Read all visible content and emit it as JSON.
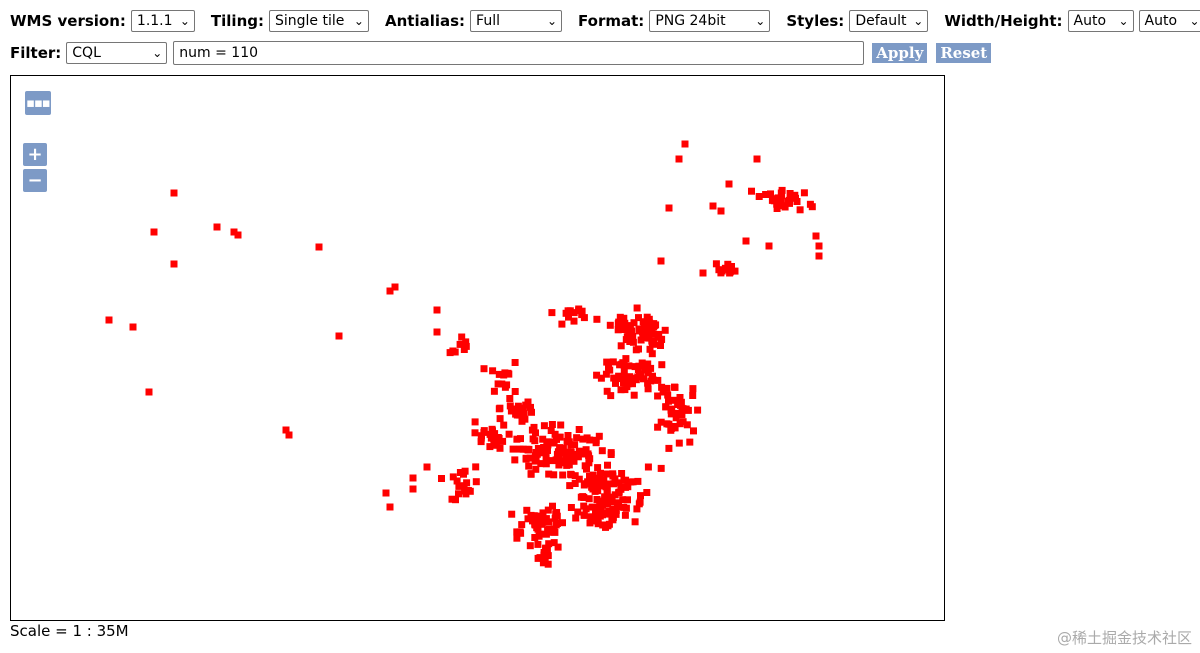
{
  "toolbar": {
    "wms_version": {
      "label": "WMS version:",
      "value": "1.1.1"
    },
    "tiling": {
      "label": "Tiling:",
      "value": "Single tile"
    },
    "antialias": {
      "label": "Antialias:",
      "value": "Full"
    },
    "format": {
      "label": "Format:",
      "value": "PNG 24bit"
    },
    "styles": {
      "label": "Styles:",
      "value": "Default"
    },
    "size": {
      "label": "Width/Height:",
      "width_value": "Auto",
      "height_value": "Auto"
    },
    "filter": {
      "label": "Filter:",
      "type_value": "CQL",
      "expression": "num = 110"
    },
    "apply_label": "Apply",
    "reset_label": "Reset",
    "chevron": "⌄"
  },
  "map": {
    "layer_switcher_glyph": "▪▪▪",
    "zoom_in_glyph": "+",
    "zoom_out_glyph": "−",
    "point_color": "#ff0000",
    "control_color": "#7d9ac6"
  },
  "scale_text": "Scale = 1 : 35M",
  "watermark": "@稀土掘金技术社区"
}
